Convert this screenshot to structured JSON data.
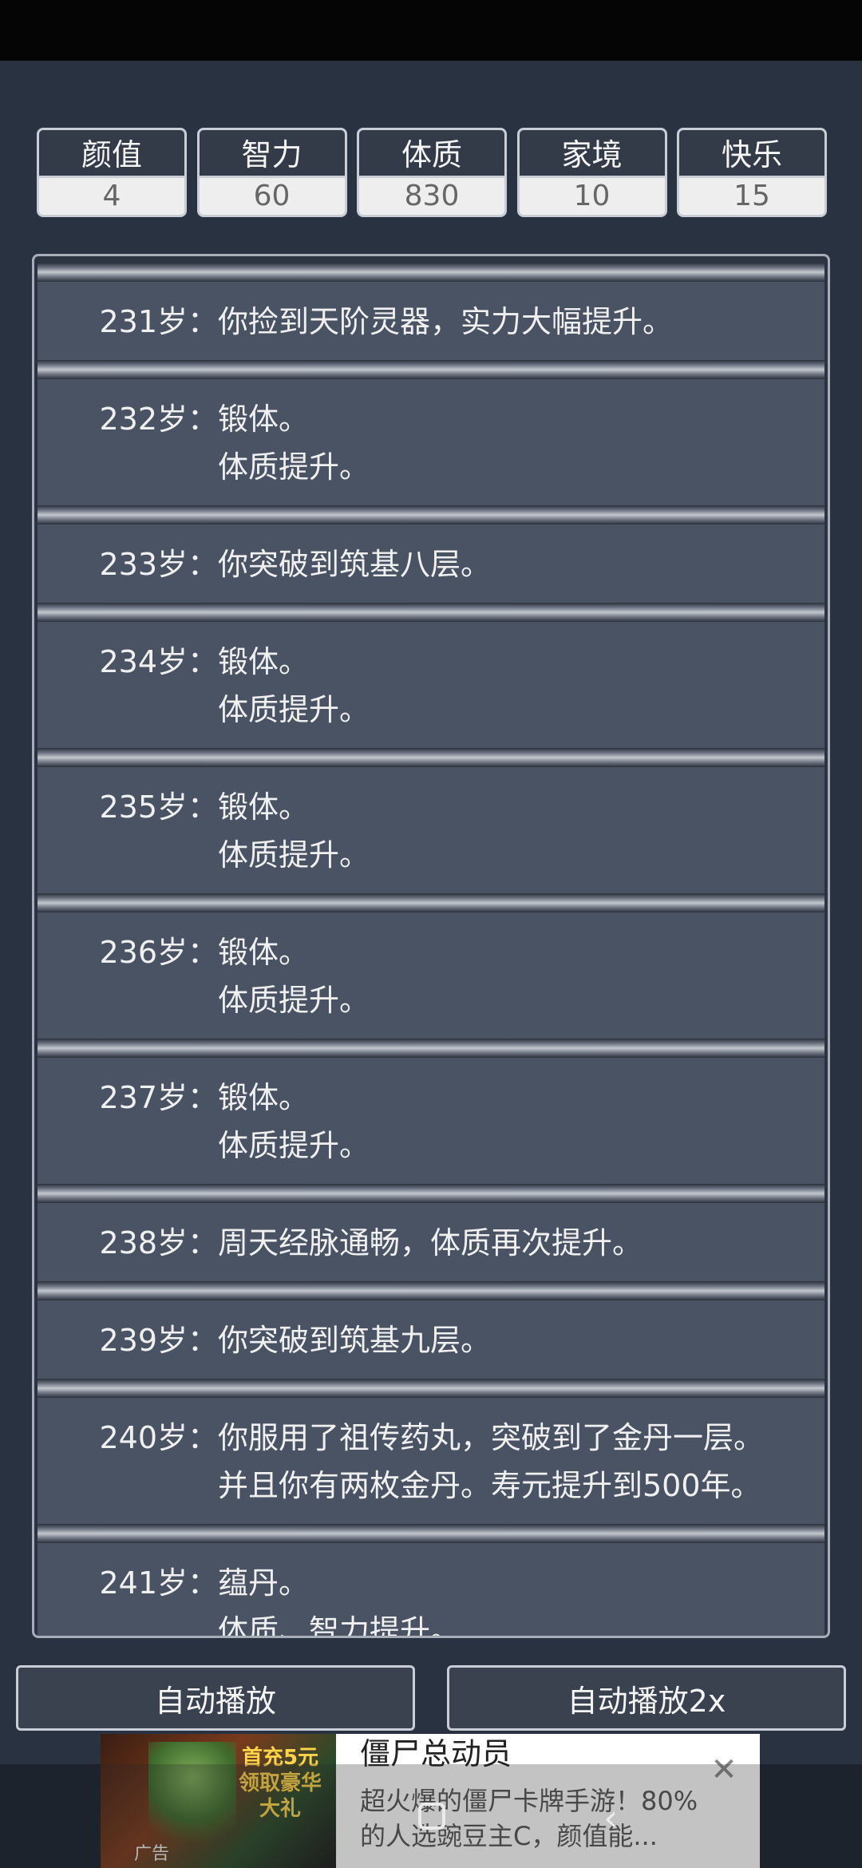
{
  "stats": [
    {
      "label": "颜值",
      "value": "4"
    },
    {
      "label": "智力",
      "value": "60"
    },
    {
      "label": "体质",
      "value": "830"
    },
    {
      "label": "家境",
      "value": "10"
    },
    {
      "label": "快乐",
      "value": "15"
    }
  ],
  "log": [
    {
      "age": "231岁：",
      "lines": [
        "你捡到天阶灵器，实力大幅提升。"
      ]
    },
    {
      "age": "232岁：",
      "lines": [
        "锻体。",
        "体质提升。"
      ]
    },
    {
      "age": "233岁：",
      "lines": [
        "你突破到筑基八层。"
      ]
    },
    {
      "age": "234岁：",
      "lines": [
        "锻体。",
        "体质提升。"
      ]
    },
    {
      "age": "235岁：",
      "lines": [
        "锻体。",
        "体质提升。"
      ]
    },
    {
      "age": "236岁：",
      "lines": [
        "锻体。",
        "体质提升。"
      ]
    },
    {
      "age": "237岁：",
      "lines": [
        "锻体。",
        "体质提升。"
      ]
    },
    {
      "age": "238岁：",
      "lines": [
        "周天经脉通畅，体质再次提升。"
      ]
    },
    {
      "age": "239岁：",
      "lines": [
        "你突破到筑基九层。"
      ]
    },
    {
      "age": "240岁：",
      "lines": [
        "你服用了祖传药丸，突破到了金丹一层。",
        "并且你有两枚金丹。寿元提升到500年。"
      ]
    },
    {
      "age": "241岁：",
      "lines": [
        "蕴丹。",
        "体质、智力提升。"
      ]
    }
  ],
  "buttons": {
    "auto_play": "自动播放",
    "auto_play_2x": "自动播放2x"
  },
  "ad": {
    "title": "僵尸总动员",
    "description": "超火爆的僵尸卡牌手游！80%的人选豌豆主C，颜值能...",
    "promo": "首充5元 领取豪华大礼",
    "badge": "广告",
    "close_icon": "close-icon"
  }
}
